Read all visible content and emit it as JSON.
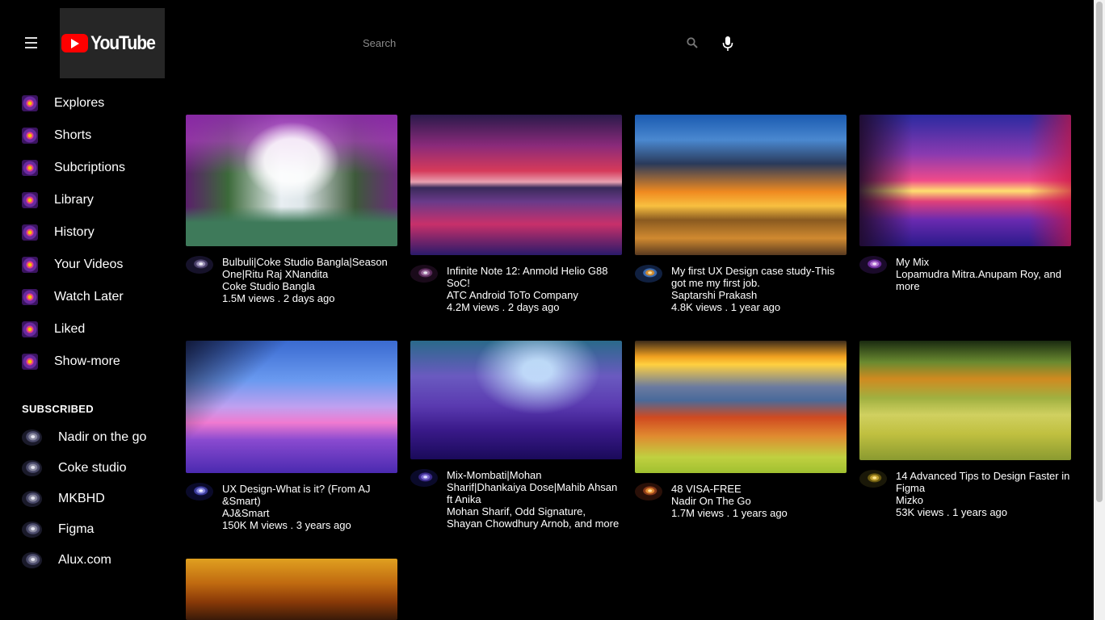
{
  "header": {
    "logo_text": "YouTube",
    "search_placeholder": "Search"
  },
  "sidebar": {
    "items": [
      {
        "label": "Explores"
      },
      {
        "label": "Shorts"
      },
      {
        "label": "Subcriptions"
      },
      {
        "label": "Library"
      },
      {
        "label": "History"
      },
      {
        "label": "Your Videos"
      },
      {
        "label": "Watch Later"
      },
      {
        "label": "Liked"
      },
      {
        "label": "Show-more"
      }
    ],
    "subscribed_title": "SUBSCRIBED",
    "subscriptions": [
      {
        "label": "Nadir on the go"
      },
      {
        "label": "Coke studio"
      },
      {
        "label": "MKBHD"
      },
      {
        "label": "Figma"
      },
      {
        "label": "Alux.com"
      }
    ]
  },
  "videos": [
    {
      "title": "Bulbuli|Coke Studio Bangla|Season One|Ritu Raj XNandita",
      "channel": "Coke Studio Bangla",
      "stats": "1.5M views . 2 days ago"
    },
    {
      "title": "Infinite Note 12: Anmold Helio G88 SoC!",
      "channel": "ATC Android ToTo Company",
      "stats": "4.2M views . 2 days ago"
    },
    {
      "title": "My first UX Design case study-This got me my first job.",
      "channel": "Saptarshi Prakash",
      "stats": "4.8K views . 1 year ago"
    },
    {
      "title": "My Mix",
      "channel": "Lopamudra Mitra.Anupam Roy, and more",
      "stats": ""
    },
    {
      "title": "UX Design-What is it? (From AJ &Smart)",
      "channel": "AJ&Smart",
      "stats": "150K M views . 3 years ago"
    },
    {
      "title": "Mix-Mombati|Mohan Sharif|Dhankaiya Dose|Mahib Ahsan ft Anika",
      "channel": "Mohan Sharif, Odd Signature, Shayan Chowdhury Arnob, and more",
      "stats": ""
    },
    {
      "title": "48 VISA-FREE",
      "channel": "Nadir On The Go",
      "stats": "1.7M views . 1 years ago"
    },
    {
      "title": "14 Advanced Tips to Design Faster in Figma",
      "channel": "Mizko",
      "stats": "53K views . 1 years ago"
    },
    {
      "title": "",
      "channel": "",
      "stats": ""
    }
  ]
}
